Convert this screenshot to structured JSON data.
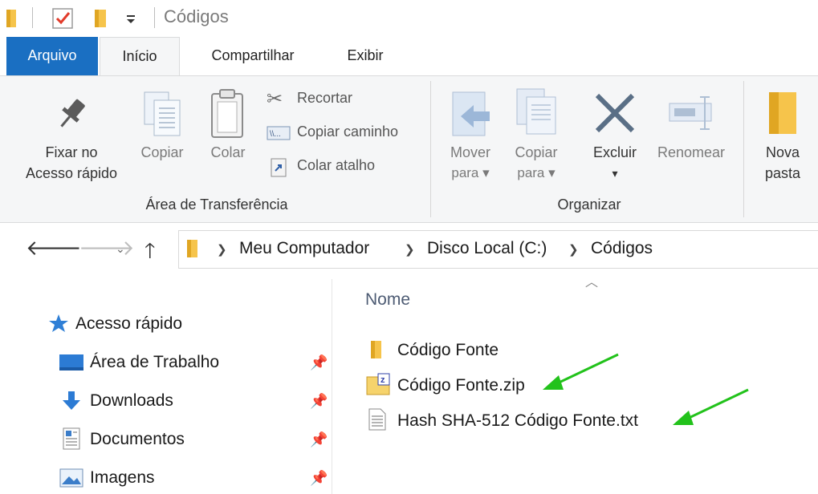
{
  "window": {
    "title": "Códigos"
  },
  "tabs": [
    {
      "label": "Arquivo"
    },
    {
      "label": "Início"
    },
    {
      "label": "Compartilhar"
    },
    {
      "label": "Exibir"
    }
  ],
  "ribbon": {
    "fixar_line1": "Fixar no",
    "fixar_line2": "Acesso rápido",
    "copiar": "Copiar",
    "colar": "Colar",
    "recortar": "Recortar",
    "copiar_caminho": "Copiar caminho",
    "colar_atalho": "Colar atalho",
    "group_clipboard": "Área de Transferência",
    "mover_line1": "Mover",
    "mover_line2": "para ▾",
    "copiar_para_line1": "Copiar",
    "copiar_para_line2": "para ▾",
    "excluir": "Excluir",
    "excluir_arrow": "▾",
    "renomear": "Renomear",
    "group_organize": "Organizar",
    "nova_line1": "Nova",
    "nova_line2": "pasta"
  },
  "address": {
    "crumbs": [
      "Meu Computador",
      "Disco Local (C:)",
      "Códigos"
    ]
  },
  "nav": {
    "quick_access": "Acesso rápido",
    "items": [
      {
        "label": "Área de Trabalho"
      },
      {
        "label": "Downloads"
      },
      {
        "label": "Documentos"
      },
      {
        "label": "Imagens"
      }
    ]
  },
  "content": {
    "column_name": "Nome",
    "files": [
      {
        "name": "Código Fonte",
        "type": "folder"
      },
      {
        "name": "Código Fonte.zip",
        "type": "zip"
      },
      {
        "name": "Hash SHA-512 Código Fonte.txt",
        "type": "txt"
      }
    ]
  },
  "colors": {
    "accent": "#1a6fc2",
    "folder": "#f6c44b",
    "annotation_arrow": "#22c21b"
  }
}
